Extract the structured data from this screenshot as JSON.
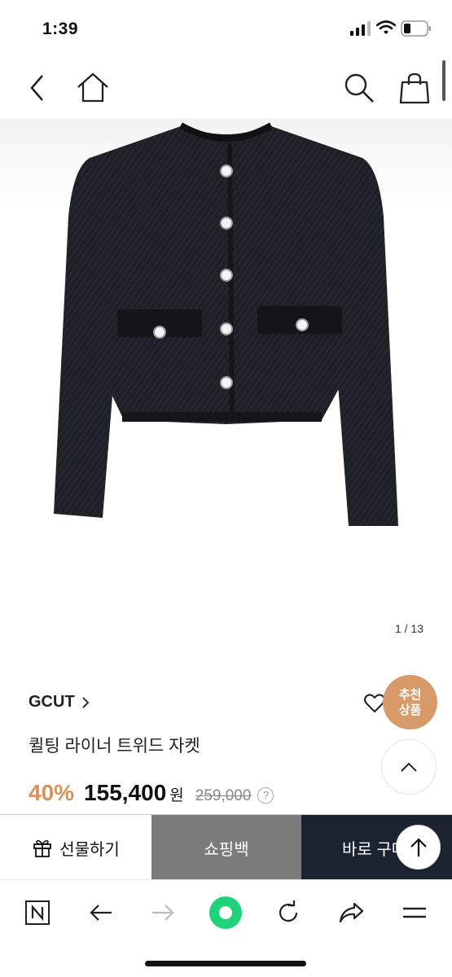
{
  "status_bar": {
    "time": "1:39"
  },
  "product": {
    "pager": "1 / 13",
    "brand": "GCUT",
    "name": "퀼팅 라이너 트위드 자켓",
    "discount": "40%",
    "price": "155,400",
    "currency": "원",
    "original_price": "259,000",
    "help_icon_label": "?"
  },
  "badges": {
    "recommend_line1": "추천",
    "recommend_line2": "상품"
  },
  "action_bar": {
    "gift_label": "선물하기",
    "cart_label": "쇼핑백",
    "buy_label": "바로 구매"
  },
  "icons": {
    "back": "chevron-left-icon",
    "home": "home-icon",
    "search": "search-icon",
    "bag": "shopping-bag-icon",
    "heart": "heart-icon",
    "gift": "gift-icon"
  },
  "colors": {
    "discount": "#d9925a",
    "recommend_badge": "#d99a6a",
    "cart_button": "#7b7b7b",
    "buy_button": "#1b2330",
    "browser_accent": "#1fd37a"
  }
}
